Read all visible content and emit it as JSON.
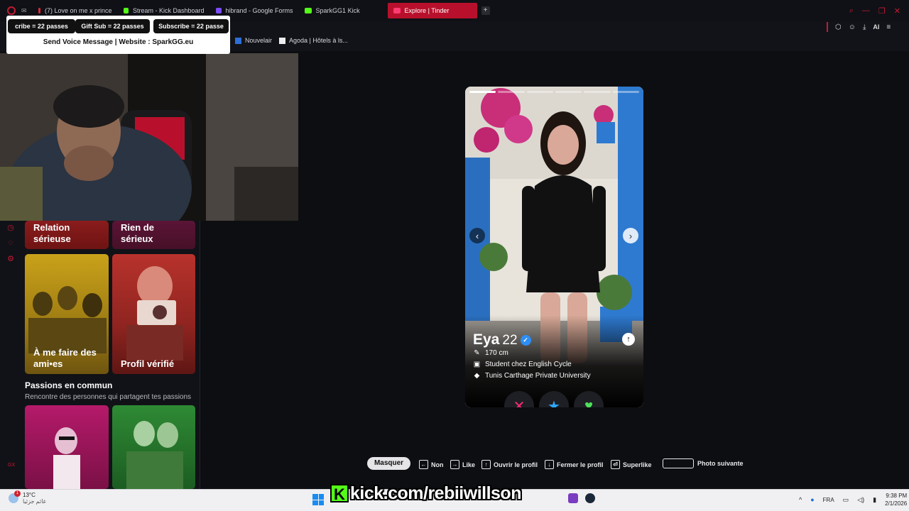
{
  "browser": {
    "tabs": [
      {
        "label": "(7) Love on me x prince",
        "color": "#e0263a"
      },
      {
        "label": "Stream - Kick Dashboard",
        "color": "#53fc18"
      },
      {
        "label": "hibrand - Google Forms",
        "color": "#7c4dff"
      },
      {
        "label": "SparkGG1 Kick",
        "color": "#53fc18"
      },
      {
        "label": "Explore | Tinder",
        "color": "#fe3c72",
        "active": true
      }
    ],
    "bookmarks": [
      "Nouvelair",
      "Agoda | Hôtels à ls..."
    ],
    "ai_label": "AI"
  },
  "overlay": {
    "pills": [
      "cribe = 22 passes",
      "Gift Sub = 22 passes",
      "Subscribe = 22 passe"
    ],
    "message": "Send Voice Message | Website : SparkGG.eu"
  },
  "explore": {
    "top_cards": [
      "Relation sérieuse",
      "Rien de sérieux"
    ],
    "cards": [
      "À me faire des ami•es",
      "Profil vérifié"
    ],
    "section_title": "Passions en commun",
    "section_subtitle": "Rencontre des personnes qui partagent tes passions",
    "gx": "GX"
  },
  "profile": {
    "name": "Eya",
    "age": "22",
    "height": "170 cm",
    "job": "Student chez English Cycle",
    "school": "Tunis Carthage Private University",
    "photo_count": 6,
    "current_photo": 1
  },
  "shortcuts": {
    "hide": "Masquer",
    "no": "Non",
    "like": "Like",
    "open": "Ouvrir le profil",
    "close": "Fermer le profil",
    "superlike": "Superlike",
    "next_photo": "Photo suivante"
  },
  "taskbar": {
    "temperature": "13°C",
    "weather_note": "غائم جزئيا",
    "lang": "FRA",
    "time": "9:38 PM",
    "date": "2/1/2026",
    "notif_count": "1",
    "kick_url": "kick.com/rebiiwillson"
  },
  "colors": {
    "accent": "#b8102c",
    "tinder_nope": "#fe2a7a",
    "tinder_super": "#2fa8ff",
    "tinder_like": "#4ee05a",
    "kick_green": "#53fc18"
  }
}
